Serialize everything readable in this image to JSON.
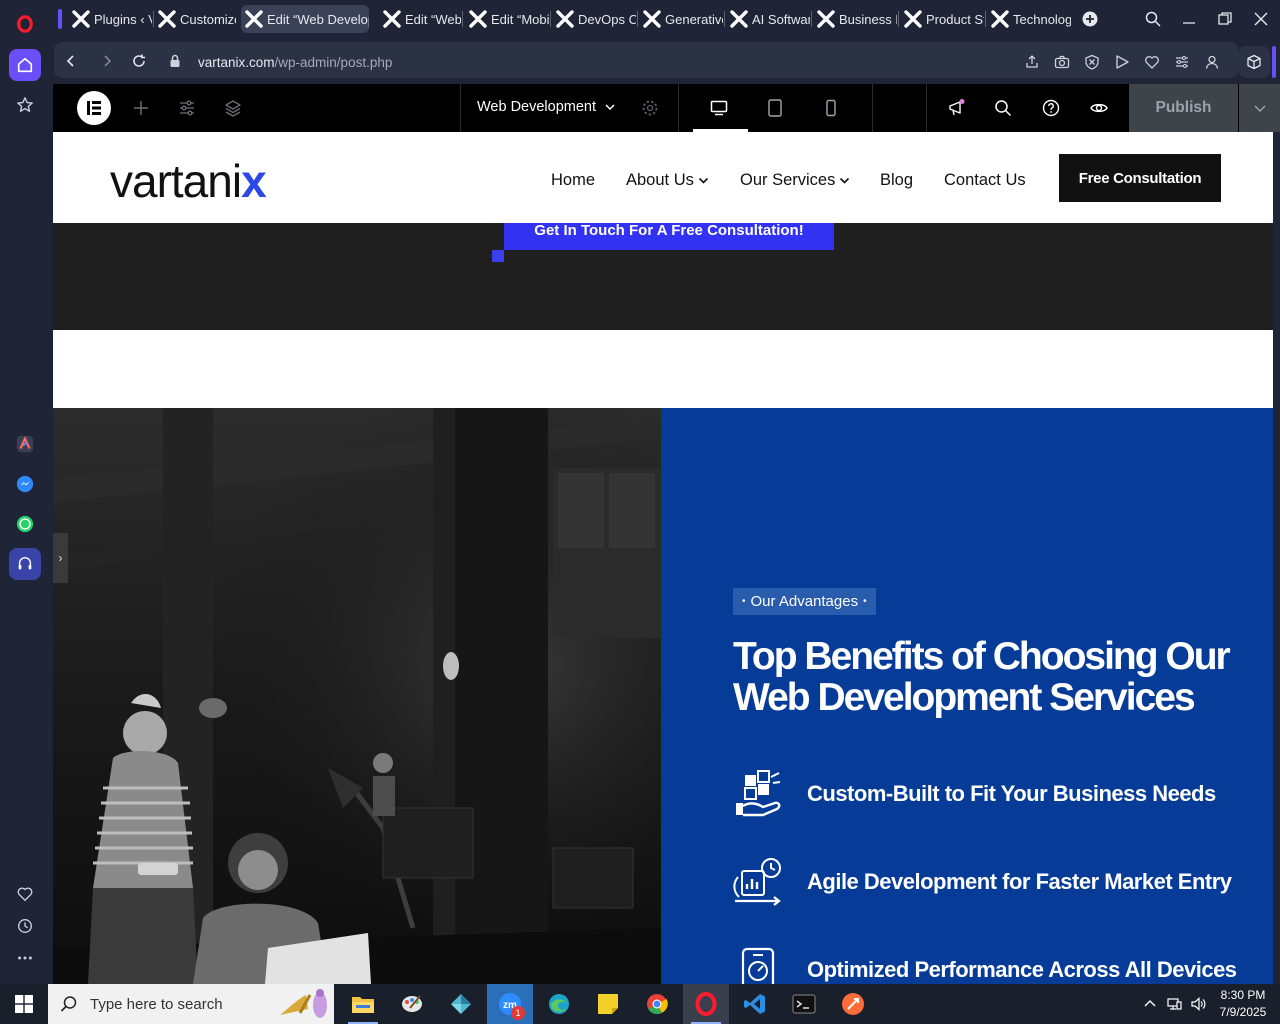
{
  "browser": {
    "tabs": [
      {
        "label": "Plugins ‹ V"
      },
      {
        "label": "Customize"
      },
      {
        "label": "Edit “Web Develop"
      },
      {
        "label": "Edit “Web"
      },
      {
        "label": "Edit “Mobi"
      },
      {
        "label": "DevOps Cc"
      },
      {
        "label": "Generative"
      },
      {
        "label": "AI Software"
      },
      {
        "label": "Business Pi"
      },
      {
        "label": "Product St"
      },
      {
        "label": "Technolog"
      }
    ],
    "active_tab_index": 2,
    "url_host": "vartanix.com",
    "url_path": "/wp-admin/post.php"
  },
  "elementor": {
    "page_name": "Web Development",
    "publish_label": "Publish"
  },
  "site": {
    "brand_main": "vartani",
    "brand_accent": "x",
    "nav": [
      {
        "label": "Home",
        "has_dropdown": false
      },
      {
        "label": "About Us",
        "has_dropdown": true
      },
      {
        "label": "Our Services",
        "has_dropdown": true
      },
      {
        "label": "Blog",
        "has_dropdown": false
      },
      {
        "label": "Contact Us",
        "has_dropdown": false
      }
    ],
    "cta_label": "Free Consultation",
    "get_in_touch_label": "Get In Touch For A Free Consultation!"
  },
  "advantages": {
    "badge_label": "Our Advantages",
    "title_line1": "Top Benefits of Choosing Our",
    "title_line2": "Web Development Services",
    "items": [
      {
        "text": "Custom-Built to Fit Your Business Needs",
        "icon": "puzzle-hand-icon"
      },
      {
        "text": "Agile Development for Faster Market Entry",
        "icon": "agile-clock-icon"
      },
      {
        "text": "Optimized Performance Across All Devices",
        "icon": "performance-device-icon"
      }
    ]
  },
  "taskbar": {
    "search_placeholder": "Type here to search",
    "time": "8:30 PM",
    "date": "7/9/2025",
    "zoom_badge": "1"
  },
  "colors": {
    "brand_blue": "#2c48e6",
    "advantages_bg": "#063c97",
    "cta_bg": "#111111",
    "get_in_touch_bg": "#3132f2"
  }
}
